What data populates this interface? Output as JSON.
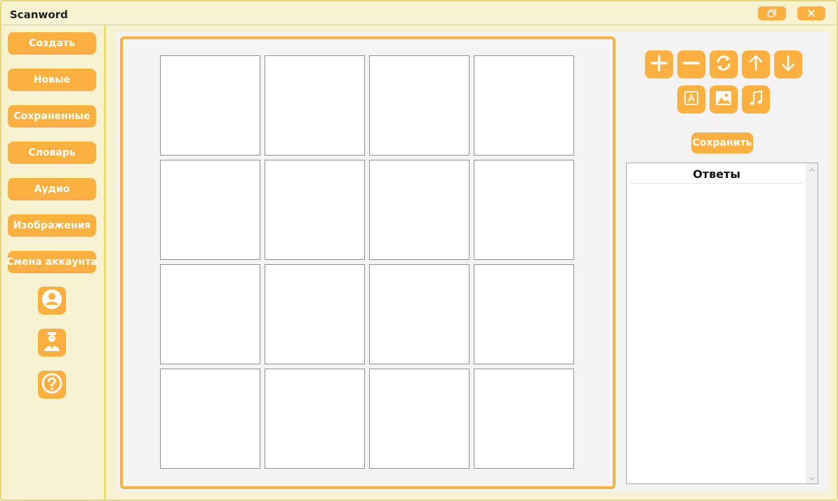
{
  "app": {
    "title": "Scanword"
  },
  "window_controls": [
    {
      "name": "restore-icon"
    },
    {
      "name": "close-icon"
    }
  ],
  "sidebar": {
    "items": [
      {
        "label": "Создать"
      },
      {
        "label": "Новые"
      },
      {
        "label": "Сохраненные"
      },
      {
        "label": "Словарь"
      },
      {
        "label": "Аудио"
      },
      {
        "label": "Изображения"
      },
      {
        "label": "Смена аккаунта"
      }
    ],
    "icon_buttons": [
      {
        "icon": "user-icon"
      },
      {
        "icon": "teacher-icon"
      },
      {
        "icon": "help-icon"
      }
    ]
  },
  "board": {
    "rows": 4,
    "cols": 4
  },
  "toolbar": {
    "row1": [
      "plus-icon",
      "minus-icon",
      "refresh-icon",
      "arrow-up-icon",
      "arrow-down-icon"
    ],
    "row2": [
      "text-icon",
      "image-icon",
      "music-icon"
    ]
  },
  "save": {
    "label": "Сохранить"
  },
  "answers": {
    "header": "Ответы",
    "items": []
  },
  "colors": {
    "accent": "#fbb040",
    "background": "#f6f2d2",
    "border": "#e3d87a"
  }
}
